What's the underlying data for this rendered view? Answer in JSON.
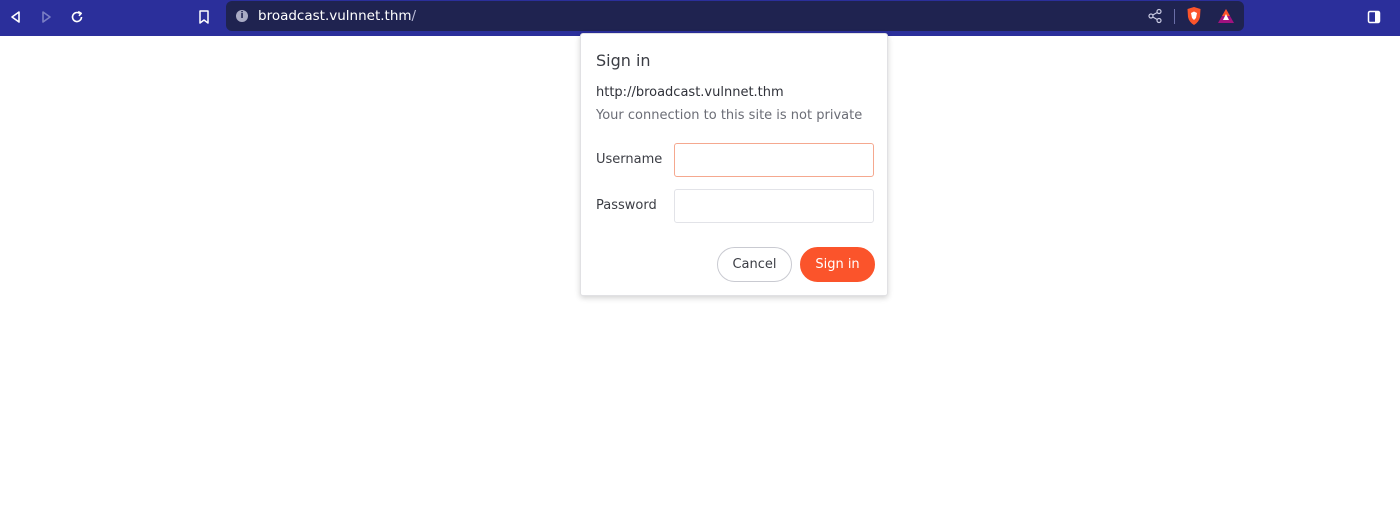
{
  "browser": {
    "url_host": "broadcast.vulnnet.thm",
    "url_path": "/",
    "info_icon": "i",
    "icons": {
      "back": "back-arrow-icon",
      "forward": "forward-arrow-icon",
      "reload": "reload-icon",
      "bookmark": "bookmark-icon",
      "share": "share-icon",
      "shields": "brave-shields-icon",
      "rewards": "brave-rewards-icon",
      "sidebar": "sidebar-toggle-icon"
    },
    "colors": {
      "toolbar": "#2b2f9b",
      "urlbar": "#1f2350"
    }
  },
  "auth_dialog": {
    "title": "Sign in",
    "origin": "http://broadcast.vulnnet.thm",
    "warning": "Your connection to this site is not private",
    "username_label": "Username",
    "username_value": "",
    "password_label": "Password",
    "password_value": "",
    "cancel_label": "Cancel",
    "signin_label": "Sign in",
    "colors": {
      "accent": "#fb542b",
      "focus_border": "#f5a88f"
    }
  }
}
